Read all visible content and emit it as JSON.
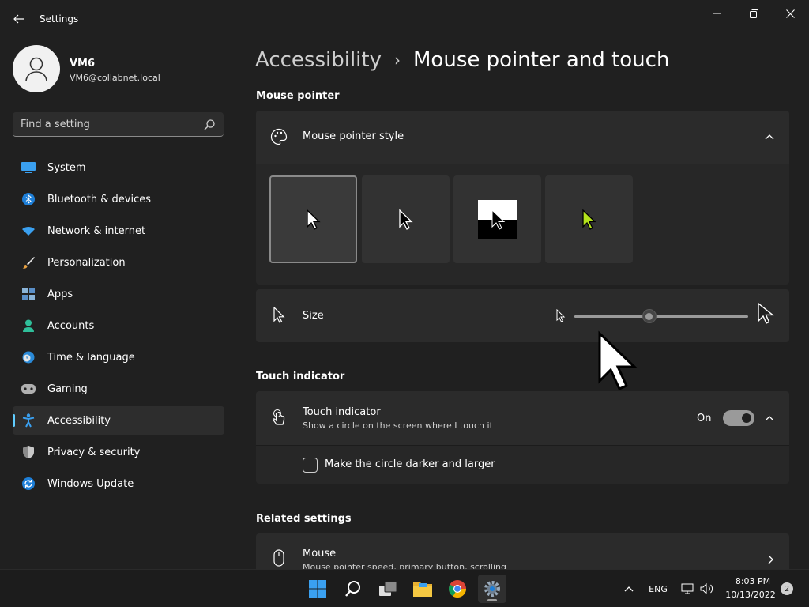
{
  "window": {
    "title": "Settings"
  },
  "profile": {
    "name": "VM6",
    "email": "VM6@collabnet.local"
  },
  "search": {
    "placeholder": "Find a setting"
  },
  "sidebar": {
    "items": [
      {
        "label": "System",
        "icon": "monitor-icon",
        "active": false
      },
      {
        "label": "Bluetooth & devices",
        "icon": "bluetooth-icon",
        "active": false
      },
      {
        "label": "Network & internet",
        "icon": "wifi-icon",
        "active": false
      },
      {
        "label": "Personalization",
        "icon": "brush-icon",
        "active": false
      },
      {
        "label": "Apps",
        "icon": "apps-icon",
        "active": false
      },
      {
        "label": "Accounts",
        "icon": "person-icon",
        "active": false
      },
      {
        "label": "Time & language",
        "icon": "clock-globe-icon",
        "active": false
      },
      {
        "label": "Gaming",
        "icon": "gamepad-icon",
        "active": false
      },
      {
        "label": "Accessibility",
        "icon": "accessibility-icon",
        "active": true
      },
      {
        "label": "Privacy & security",
        "icon": "shield-icon",
        "active": false
      },
      {
        "label": "Windows Update",
        "icon": "update-icon",
        "active": false
      }
    ]
  },
  "breadcrumb": {
    "parent": "Accessibility",
    "separator": "›",
    "current": "Mouse pointer and touch"
  },
  "mouse_pointer": {
    "section_title": "Mouse pointer",
    "style_card_title": "Mouse pointer style",
    "style_options": [
      "white",
      "black",
      "inverted",
      "custom"
    ],
    "selected_style": "white",
    "size_label": "Size",
    "size_level": 0.43
  },
  "touch": {
    "section_title": "Touch indicator",
    "title": "Touch indicator",
    "subtitle": "Show a circle on the screen where I touch it",
    "toggle_state": "On",
    "checkbox_label": "Make the circle darker and larger"
  },
  "related": {
    "section_title": "Related settings",
    "mouse_title": "Mouse",
    "mouse_subtitle": "Mouse pointer speed, primary button, scrolling"
  },
  "taskbar": {
    "language": "ENG",
    "time": "8:03 PM",
    "date": "10/13/2022",
    "notifications": "2"
  },
  "colors": {
    "accent": "#60cdff",
    "background": "#202020",
    "card": "#2b2b2b",
    "custom_pointer": "#b4e31c"
  }
}
